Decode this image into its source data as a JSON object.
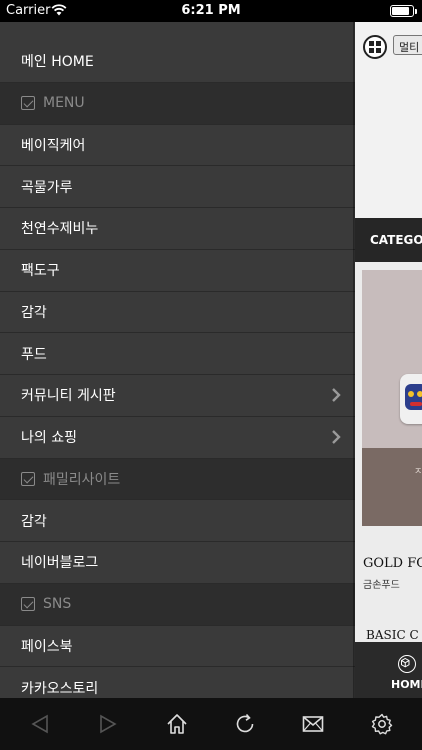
{
  "status_bar": {
    "carrier": "Carrier",
    "time": "6:21 PM",
    "battery_level": 0.85
  },
  "side_menu": {
    "items": [
      {
        "label": "메인 HOME",
        "type": "item"
      },
      {
        "label": "MENU",
        "type": "header"
      },
      {
        "label": "베이직케어",
        "type": "item"
      },
      {
        "label": "곡물가루",
        "type": "item"
      },
      {
        "label": "천연수제비누",
        "type": "item"
      },
      {
        "label": "팩도구",
        "type": "item"
      },
      {
        "label": "감각",
        "type": "item"
      },
      {
        "label": "푸드",
        "type": "item"
      },
      {
        "label": "커뮤니티 게시판",
        "type": "item",
        "has_submenu": true
      },
      {
        "label": "나의 쇼핑",
        "type": "item",
        "has_submenu": true
      },
      {
        "label": "패밀리사이트",
        "type": "header"
      },
      {
        "label": "감각",
        "type": "item"
      },
      {
        "label": "네이버블로그",
        "type": "item"
      },
      {
        "label": "SNS",
        "type": "header"
      },
      {
        "label": "페이스북",
        "type": "item"
      },
      {
        "label": "카카오스토리",
        "type": "item"
      }
    ]
  },
  "main_content": {
    "multi_button": "멀티",
    "category_bar": "CATEGO",
    "card_bottom_text": "ㅈ",
    "product1_title": "GOLD FO",
    "product1_sub": "금손푸드",
    "product2_title": "BASIC C",
    "tab_home_label": "HOME"
  },
  "toolbar": {
    "buttons": [
      "back-icon",
      "forward-icon",
      "home-icon",
      "refresh-icon",
      "mail-icon",
      "settings-icon"
    ]
  },
  "colors": {
    "menu_bg": "#3a3a3a",
    "menu_header_bg": "#2d2d2d",
    "toolbar_bg": "#111111"
  }
}
